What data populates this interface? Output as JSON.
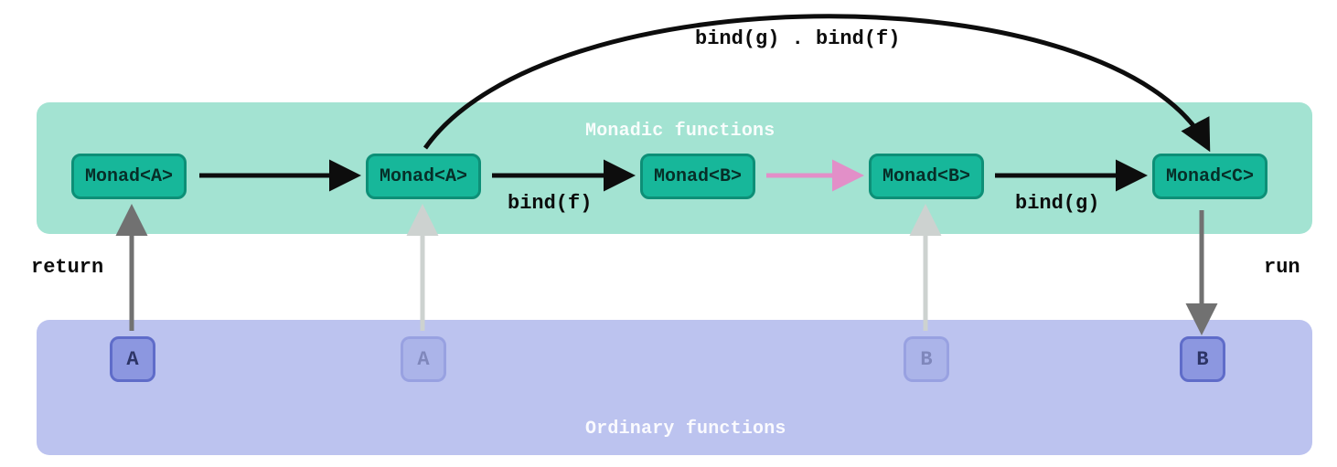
{
  "regions": {
    "monadic_label": "Monadic functions",
    "ordinary_label": "Ordinary functions"
  },
  "top_nodes": {
    "m0": "Monad<A>",
    "m1": "Monad<A>",
    "m2": "Monad<B>",
    "m3": "Monad<B>",
    "m4": "Monad<C>"
  },
  "bottom_nodes": {
    "v0": "A",
    "v1": "A",
    "v2": "B",
    "v3": "B"
  },
  "labels": {
    "return": "return",
    "run": "run",
    "bind_f": "bind(f)",
    "bind_g": "bind(g)",
    "composed": "bind(g) . bind(f)"
  },
  "colors": {
    "monadic_bg": "#a3e3d2",
    "ordinary_bg": "#bcc3ef",
    "monad_fill": "#17b79a",
    "monad_stroke": "#0d8f77",
    "value_fill": "#8c97e0",
    "value_stroke": "#5f6cc9",
    "arrow_black": "#0d0d0d",
    "arrow_gray": "#717171",
    "arrow_faded": "#d0d4d2",
    "arrow_pinkish": "#e28fc8"
  }
}
